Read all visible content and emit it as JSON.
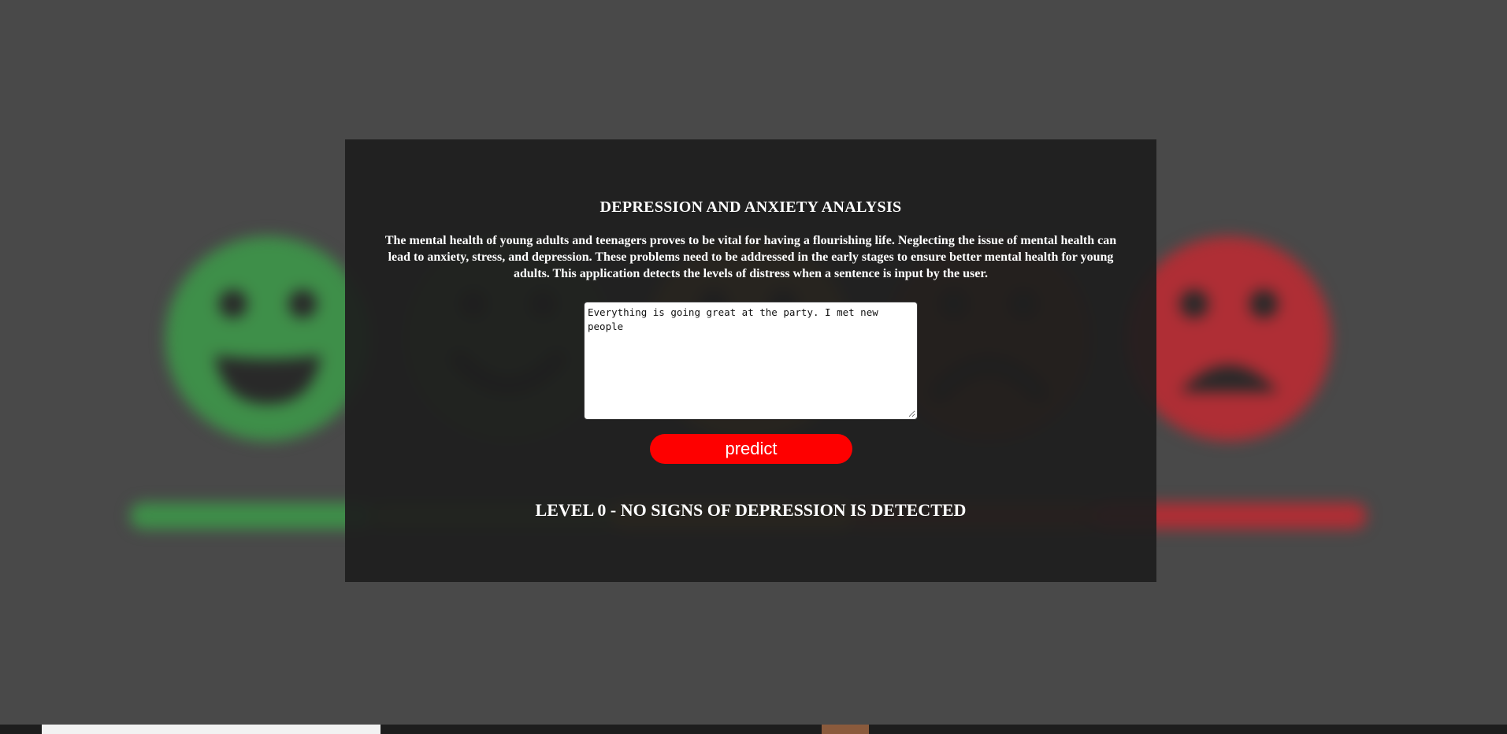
{
  "header": {
    "title": "DEPRESSION AND ANXIETY ANALYSIS",
    "description": "The mental health of young adults and teenagers proves to be vital for having a flourishing life. Neglecting the issue of mental health can lead to anxiety, stress, and depression. These problems need to be addressed in the early stages to ensure better mental health for young adults. This application detects the levels of distress when a sentence is input by the user."
  },
  "form": {
    "input_value": "Everything is going great at the party. I met new people",
    "predict_label": "predict"
  },
  "result": {
    "text": "LEVEL 0 - NO SIGNS OF DEPRESSION IS DETECTED"
  },
  "background": {
    "faces": [
      {
        "name": "very-happy-face-icon",
        "color": "#3ab54a"
      },
      {
        "name": "happy-face-icon",
        "color": "#4a7a35"
      },
      {
        "name": "neutral-face-icon",
        "color": "#c98a1e"
      },
      {
        "name": "sad-face-icon",
        "color": "#8a3214"
      },
      {
        "name": "distressed-face-icon",
        "color": "#e6212b"
      }
    ],
    "bar_colors": [
      "#3ab54a",
      "#5c8a2e",
      "#d99a1c",
      "#b8401a",
      "#e6212b"
    ]
  },
  "colors": {
    "accent": "#fe0000",
    "panel": "#1e1e1e",
    "page": "#4a4a4a"
  }
}
